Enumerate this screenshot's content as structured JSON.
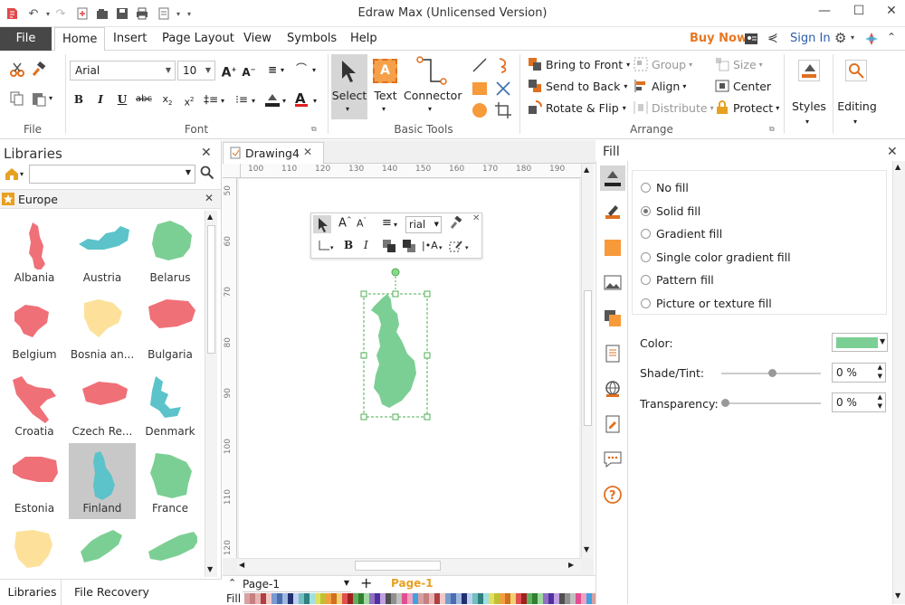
{
  "app": {
    "title": "Edraw Max (Unlicensed Version)"
  },
  "menu": {
    "file": "File",
    "tabs": [
      "Home",
      "Insert",
      "Page Layout",
      "View",
      "Symbols",
      "Help"
    ],
    "buy_now": "Buy Now",
    "sign_in": "Sign In"
  },
  "ribbon": {
    "font_name": "Arial",
    "font_size": "10",
    "groups": {
      "file": "File",
      "font": "Font",
      "basic_tools": "Basic Tools",
      "arrange": "Arrange"
    },
    "basic": {
      "select": "Select",
      "text": "Text",
      "connector": "Connector"
    },
    "arrange": {
      "bring_to_front": "Bring to Front",
      "send_to_back": "Send to Back",
      "rotate_flip": "Rotate & Flip",
      "group": "Group",
      "align": "Align",
      "distribute": "Distribute",
      "size": "Size",
      "center": "Center",
      "protect": "Protect"
    },
    "styles": "Styles",
    "editing": "Editing"
  },
  "libraries": {
    "title": "Libraries",
    "category": "Europe",
    "shapes": [
      {
        "label": "Albania",
        "color": "#f07078"
      },
      {
        "label": "Austria",
        "color": "#5bc3c9"
      },
      {
        "label": "Belarus",
        "color": "#7ccf94"
      },
      {
        "label": "Belgium",
        "color": "#f07078"
      },
      {
        "label": "Bosnia an...",
        "color": "#fde19a"
      },
      {
        "label": "Bulgaria",
        "color": "#f07078"
      },
      {
        "label": "Croatia",
        "color": "#f07078"
      },
      {
        "label": "Czech Re...",
        "color": "#f07078"
      },
      {
        "label": "Denmark",
        "color": "#5bc3c9"
      },
      {
        "label": "Estonia",
        "color": "#f07078"
      },
      {
        "label": "Finland",
        "color": "#5bc3c9"
      },
      {
        "label": "France",
        "color": "#7ccf94"
      },
      {
        "label": "",
        "color": "#fde19a"
      },
      {
        "label": "",
        "color": "#7ccf94"
      },
      {
        "label": "",
        "color": "#7ccf94"
      }
    ],
    "bottom_tabs": [
      "Libraries",
      "File Recovery"
    ]
  },
  "document": {
    "tab": "Drawing4",
    "ruler_top": [
      "100",
      "110",
      "120",
      "130",
      "140",
      "150",
      "160",
      "170",
      "180",
      "190"
    ],
    "ruler_left": [
      "50",
      "60",
      "70",
      "80",
      "90",
      "100",
      "110",
      "120"
    ],
    "float_font": "rial",
    "page_select": "Page-1",
    "page_tab": "Page-1",
    "fill_label": "Fill",
    "shape_color": "#7ccf94"
  },
  "fill": {
    "title": "Fill",
    "options": [
      "No fill",
      "Solid fill",
      "Gradient fill",
      "Single color gradient fill",
      "Pattern fill",
      "Picture or texture fill"
    ],
    "selected_option": "Solid fill",
    "color_label": "Color:",
    "color_value": "#7ccf94",
    "shade_label": "Shade/Tint:",
    "shade_value": "0 %",
    "transparency_label": "Transparency:",
    "transparency_value": "0 %"
  },
  "colors": {
    "accent": "#e87722",
    "file_tab": "#474747",
    "link": "#2a5db0"
  }
}
